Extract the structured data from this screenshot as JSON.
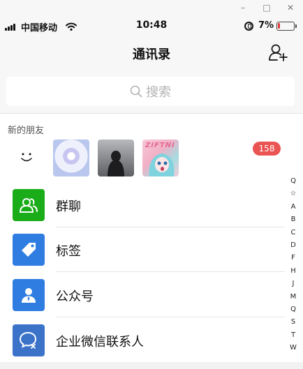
{
  "window": {
    "minimize_glyph": "–",
    "maximize_glyph": "□",
    "close_glyph": "✕"
  },
  "status_bar": {
    "carrier": "中国移动",
    "time": "10:48",
    "battery_percent": "7%",
    "battery_color": "#e03a3a"
  },
  "nav": {
    "title": "通讯录",
    "add_friend_icon": "add-friend-icon"
  },
  "search": {
    "placeholder": "搜索",
    "icon": "search-icon"
  },
  "new_friends": {
    "label": "新的朋友",
    "thumb3_text": "ZIFTNI",
    "badge_count": "158",
    "badge_color": "#ea5453"
  },
  "items": [
    {
      "label": "群聊",
      "icon": "group-chat-icon",
      "color": "#1aad19"
    },
    {
      "label": "标签",
      "icon": "tag-icon",
      "color": "#2f7de1"
    },
    {
      "label": "公众号",
      "icon": "official-account-icon",
      "color": "#2f7de1"
    },
    {
      "label": "企业微信联系人",
      "icon": "work-wechat-icon",
      "color": "#3a73c8"
    }
  ],
  "index": [
    "Q",
    "☆",
    "A",
    "B",
    "C",
    "D",
    "F",
    "H",
    "J",
    "M",
    "Q",
    "S",
    "T",
    "W"
  ]
}
